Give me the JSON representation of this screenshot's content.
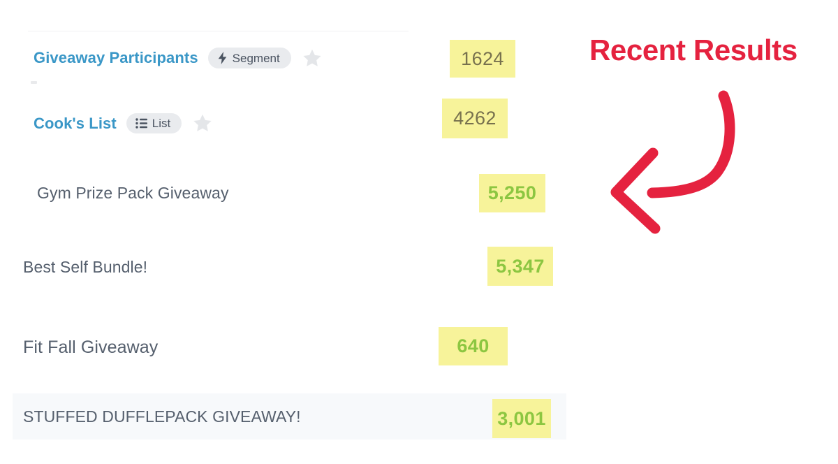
{
  "annotation": {
    "title": "Recent Results",
    "title_color": "#e5223f",
    "arrow_color": "#e5223f",
    "arrow_icon": "curved-arrow-left-icon"
  },
  "palette": {
    "highlight_bg": "#f7f39a",
    "count_plain_text": "#77714e",
    "count_green_text": "#8cc641",
    "link_blue": "#3a97c7",
    "label_gray": "#555f6d",
    "badge_bg": "#e9ebee",
    "star_gray": "#e4e6e9",
    "row_band_bg": "#f7f9fb",
    "divider": "#f0f1f3"
  },
  "rows": [
    {
      "label": "Giveaway Participants",
      "style": "link",
      "badge": {
        "text": "Segment",
        "icon": "lightning-bolt-icon"
      },
      "star": true,
      "count": "1624",
      "count_style": "plain"
    },
    {
      "label": "Cook's List",
      "style": "link",
      "badge": {
        "text": "List",
        "icon": "bulleted-list-icon"
      },
      "star": true,
      "count": "4262",
      "count_style": "plain"
    },
    {
      "label": "Gym Prize Pack Giveaway",
      "style": "plain",
      "badge": null,
      "star": false,
      "count": "5,250",
      "count_style": "green"
    },
    {
      "label": "Best Self Bundle!",
      "style": "plain",
      "badge": null,
      "star": false,
      "count": "5,347",
      "count_style": "green"
    },
    {
      "label": "Fit Fall Giveaway",
      "style": "plain",
      "badge": null,
      "star": false,
      "count": "640",
      "count_style": "green"
    },
    {
      "label": "STUFFED DUFFLEPACK GIVEAWAY!",
      "style": "plain",
      "badge": null,
      "star": false,
      "count": "3,001",
      "count_style": "green"
    }
  ]
}
